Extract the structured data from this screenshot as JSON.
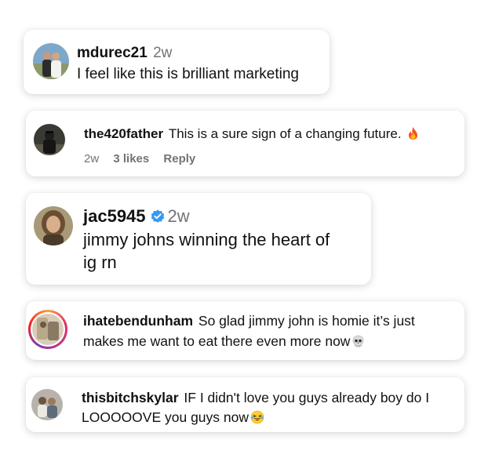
{
  "comments": [
    {
      "username": "mdurec21",
      "time": "2w",
      "text": "I feel like this is brilliant marketing"
    },
    {
      "username": "the420father",
      "text": "This is a sure sign of a changing future.",
      "emoji": "fire",
      "time": "2w",
      "likes": "3 likes",
      "reply": "Reply"
    },
    {
      "username": "jac5945",
      "time": "2w",
      "text_line1": "jimmy johns winning the heart of",
      "text_line2": "ig rn",
      "verified_color": "#3897f0"
    },
    {
      "username": "ihatebendunham",
      "text_line1": "So glad jimmy john is homie it’s just",
      "text_line2": "makes me want to eat there even more now",
      "emoji": "skull"
    },
    {
      "username": "thisbitchskylar",
      "text_line1": "IF I didn't love you guys already boy do I",
      "text_line2": "LOOOOOVE you guys now",
      "emoji": "laughing"
    }
  ]
}
